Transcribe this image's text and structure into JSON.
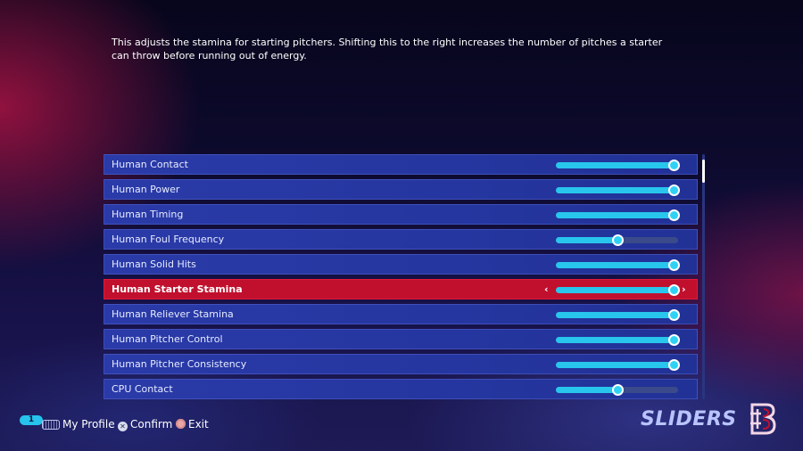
{
  "description": "This adjusts the stamina for starting pitchers. Shifting this to the right increases the number of pitches a starter can throw before running out of energy.",
  "sliders": [
    {
      "label": "Human Contact",
      "value": 0.96,
      "selected": false
    },
    {
      "label": "Human Power",
      "value": 0.96,
      "selected": false
    },
    {
      "label": "Human Timing",
      "value": 0.96,
      "selected": false
    },
    {
      "label": "Human Foul Frequency",
      "value": 0.5,
      "selected": false
    },
    {
      "label": "Human Solid Hits",
      "value": 0.96,
      "selected": false
    },
    {
      "label": "Human Starter Stamina",
      "value": 0.96,
      "selected": true
    },
    {
      "label": "Human Reliever Stamina",
      "value": 0.96,
      "selected": false
    },
    {
      "label": "Human Pitcher Control",
      "value": 0.96,
      "selected": false
    },
    {
      "label": "Human Pitcher Consistency",
      "value": 0.96,
      "selected": false
    },
    {
      "label": "CPU Contact",
      "value": 0.5,
      "selected": false
    }
  ],
  "selected_arrows": {
    "left": "‹",
    "right": "›"
  },
  "footer": {
    "badge": "1",
    "profile_label": "My Profile",
    "confirm_icon": "✕",
    "confirm_label": "Confirm",
    "exit_label": "Exit"
  },
  "screen_title": "SLIDERS",
  "colors": {
    "row": "#2536a0",
    "selected_row": "#c0102d",
    "slider_fill": "#28c6ec",
    "track": "#3a4a8a",
    "title": "#b9c4ff"
  },
  "icons": [
    "touchpad-icon",
    "cross-button-icon",
    "circle-button-icon",
    "team-logo-icon"
  ]
}
